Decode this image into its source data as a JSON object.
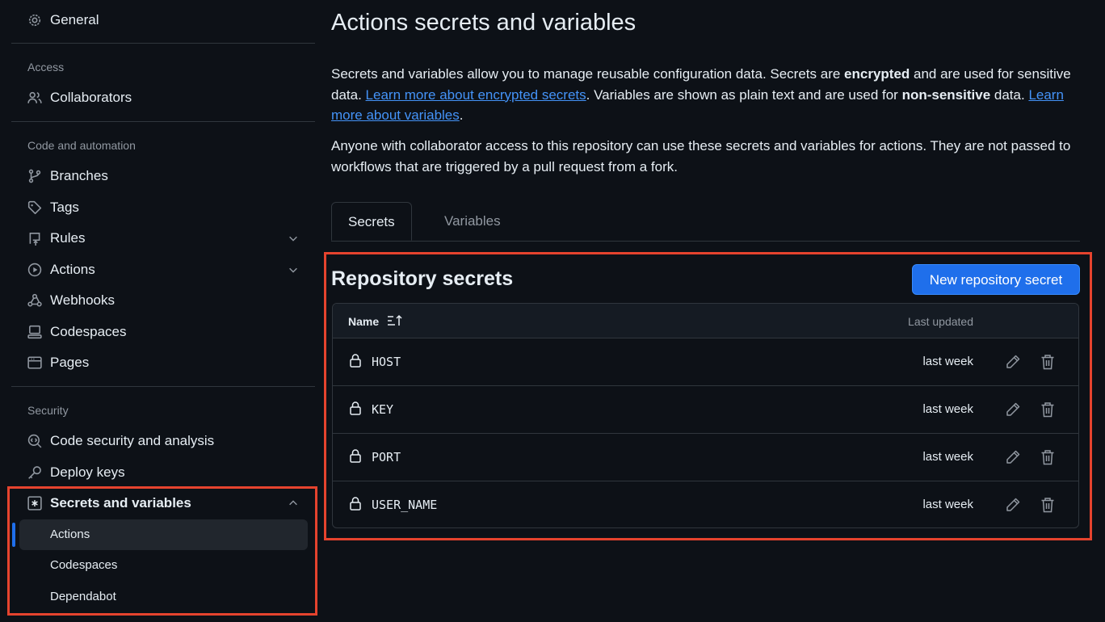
{
  "sidebar": {
    "general": "General",
    "access_heading": "Access",
    "collaborators": "Collaborators",
    "code_heading": "Code and automation",
    "branches": "Branches",
    "tags": "Tags",
    "rules": "Rules",
    "actions": "Actions",
    "webhooks": "Webhooks",
    "codespaces": "Codespaces",
    "pages": "Pages",
    "security_heading": "Security",
    "code_security": "Code security and analysis",
    "deploy_keys": "Deploy keys",
    "secrets_variables": "Secrets and variables",
    "sub_items": [
      "Actions",
      "Codespaces",
      "Dependabot"
    ]
  },
  "main": {
    "title": "Actions secrets and variables",
    "intro": {
      "t1": "Secrets and variables allow you to manage reusable configuration data. Secrets are ",
      "b1": "encrypted",
      "t2": " and are used for sensitive data. ",
      "link1": "Learn more about encrypted secrets",
      "t3": ". Variables are shown as plain text and are used for ",
      "b2": "non-sensitive",
      "t4": " data. ",
      "link2": "Learn more about variables",
      "t5": "."
    },
    "access_note": "Anyone with collaborator access to this repository can use these secrets and variables for actions. They are not passed to workflows that are triggered by a pull request from a fork.",
    "tabs": [
      "Secrets",
      "Variables"
    ],
    "section_title": "Repository secrets",
    "new_button": "New repository secret",
    "table": {
      "col_name": "Name",
      "col_updated": "Last updated",
      "rows": [
        {
          "name": "HOST",
          "updated": "last week"
        },
        {
          "name": "KEY",
          "updated": "last week"
        },
        {
          "name": "PORT",
          "updated": "last week"
        },
        {
          "name": "USER_NAME",
          "updated": "last week"
        }
      ]
    }
  },
  "colors": {
    "background": "#0d1117",
    "accent": "#1f6feb",
    "link": "#4493f8",
    "highlight": "#e5432e"
  }
}
